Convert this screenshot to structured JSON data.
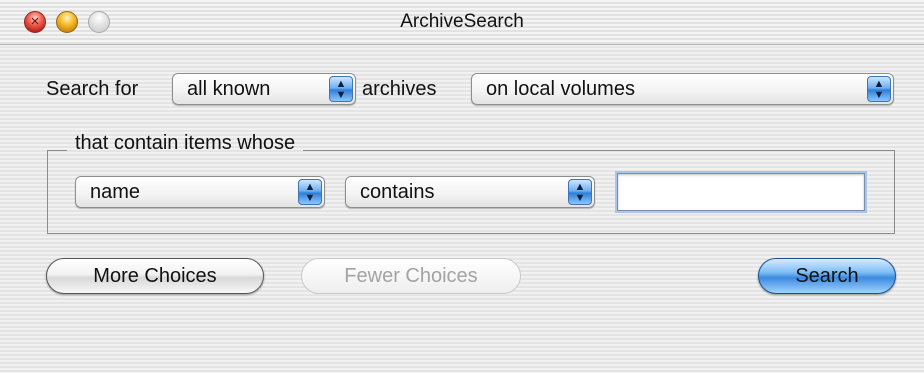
{
  "window": {
    "title": "ArchiveSearch",
    "close_glyph": "×"
  },
  "search_row": {
    "search_for_label": "Search for",
    "scope_popup": {
      "selected": "all known"
    },
    "archives_label": "archives",
    "location_popup": {
      "selected": "on local volumes"
    }
  },
  "criteria_group": {
    "title": "that contain items whose",
    "field_popup": {
      "selected": "name"
    },
    "operator_popup": {
      "selected": "contains"
    },
    "value_field": {
      "value": ""
    }
  },
  "buttons": {
    "more_choices": "More Choices",
    "fewer_choices": "Fewer Choices",
    "search": "Search"
  },
  "icons": {
    "popup_arrows": "up-down-arrows-icon",
    "close": "close-icon",
    "minimize": "minimize-icon",
    "zoom": "zoom-icon"
  },
  "colors": {
    "accent_blue": "#3d8ae0",
    "close_red": "#c4261a",
    "minimize_yellow": "#f8c43a"
  }
}
